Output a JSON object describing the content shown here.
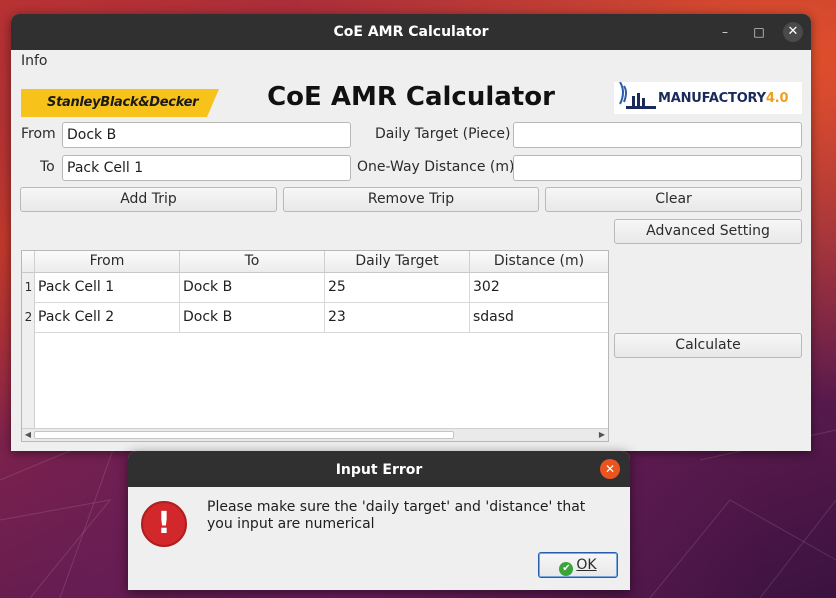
{
  "window": {
    "title": "CoE AMR Calculator",
    "controls": {
      "minimize": "–",
      "maximize": "□",
      "close": "✕"
    }
  },
  "menubar": {
    "info": "Info"
  },
  "header": {
    "brand_left": "StanleyBlack&Decker",
    "heading": "CoE AMR Calculator",
    "brand_right_name": "MANUFACTORY",
    "brand_right_version": "4.0"
  },
  "form": {
    "from_label": "From",
    "from_value": "Dock B",
    "to_label": "To",
    "to_value": "Pack Cell 1",
    "daily_target_label": "Daily Target (Piece)",
    "daily_target_value": "",
    "distance_label": "One-Way Distance (m)",
    "distance_value": ""
  },
  "buttons": {
    "add_trip": "Add Trip",
    "remove_trip": "Remove Trip",
    "clear": "Clear",
    "advanced_setting": "Advanced Setting",
    "calculate": "Calculate"
  },
  "table": {
    "columns": [
      "From",
      "To",
      "Daily Target",
      "Distance (m)"
    ],
    "rows": [
      {
        "index": "1",
        "from": "Pack Cell 1",
        "to": "Dock B",
        "daily_target": "25",
        "distance": "302"
      },
      {
        "index": "2",
        "from": "Pack Cell 2",
        "to": "Dock B",
        "daily_target": "23",
        "distance": "sdasd"
      }
    ]
  },
  "dialog": {
    "title": "Input Error",
    "close": "✕",
    "message": "Please make sure the 'daily target' and 'distance' that you input are numerical",
    "ok_label": "OK"
  },
  "colors": {
    "titlebar": "#303030",
    "window_bg": "#efefef",
    "sbd_yellow": "#f7c21a",
    "error_red": "#d2282c",
    "ubuntu_orange": "#e95420"
  }
}
